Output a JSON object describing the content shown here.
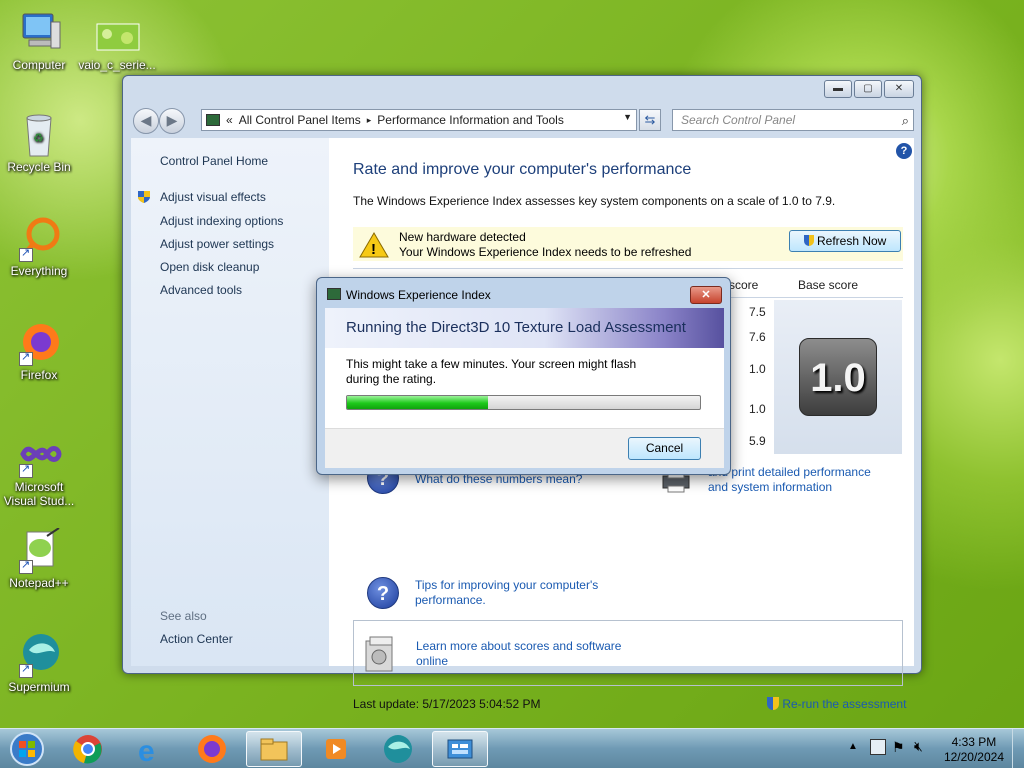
{
  "desktop": {
    "icons": [
      {
        "label": "Computer"
      },
      {
        "label": "vaio_c_serie..."
      },
      {
        "label": "Recycle Bin"
      },
      {
        "label": "Everything"
      },
      {
        "label": "Firefox"
      },
      {
        "label": "Microsoft Visual Stud..."
      },
      {
        "label": "Notepad++"
      },
      {
        "label": "Supermium"
      }
    ]
  },
  "window": {
    "address": {
      "chevrons": "«",
      "crumb1": "All Control Panel Items",
      "sep": "▸",
      "crumb2": "Performance Information and Tools"
    },
    "search_placeholder": "Search Control Panel",
    "left": {
      "home": "Control Panel Home",
      "links": [
        "Adjust visual effects",
        "Adjust indexing options",
        "Adjust power settings",
        "Open disk cleanup",
        "Advanced tools"
      ],
      "see_also": "See also",
      "action_center": "Action Center"
    },
    "main": {
      "title": "Rate and improve your computer's performance",
      "description": "The Windows Experience Index assesses key system components on a scale of 1.0 to 7.9.",
      "notice": {
        "line1": "New hardware detected",
        "line2": "Your Windows Experience Index needs to be refreshed",
        "button": "Refresh Now"
      },
      "col_subscore": "score",
      "col_base": "Base score",
      "subscores": [
        "7.5",
        "7.6",
        "1.0",
        "1.0",
        "5.9"
      ],
      "base_score": "1.0",
      "help_link1": "What do these numbers mean?",
      "print_link_l1": "and print detailed performance",
      "print_link_l2": "and system information",
      "tips_l1": "Tips for improving your computer's",
      "tips_l2": "performance.",
      "learn_l1": "Learn more about scores and software",
      "learn_l2": "online",
      "last_update": "Last update: 5/17/2023 5:04:52 PM",
      "rerun": "Re-run the assessment"
    }
  },
  "dialog": {
    "title": "Windows Experience Index",
    "heading": "Running the Direct3D 10 Texture Load Assessment",
    "body_l1": "This might take a few minutes. Your screen might flash",
    "body_l2": "during the rating.",
    "progress": 0.4,
    "cancel": "Cancel"
  },
  "taskbar": {
    "time": "4:33 PM",
    "date": "12/20/2024"
  },
  "colors": {
    "link": "#1a5ab1",
    "heading": "#1d3f7a",
    "progress": "#1ec91b"
  }
}
